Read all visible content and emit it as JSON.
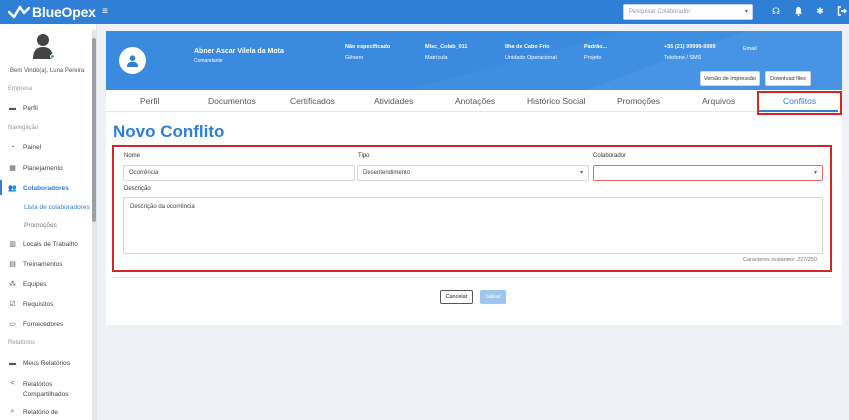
{
  "app": {
    "brand": "BlueOpex",
    "accent": "#2f7fd6"
  },
  "topbar": {
    "search_placeholder": "Pesquisar Colaborador",
    "icons": [
      "menu-icon",
      "headset-icon",
      "bell-icon",
      "gear-icon",
      "logout-icon"
    ]
  },
  "sidebar": {
    "welcome": "Bem Vindo(a), Luna Pereira",
    "sections": {
      "empresa": "Empresa",
      "navegacao": "Navegação",
      "relatorios": "Relatórios"
    },
    "items": {
      "perfil": "Perfil",
      "painel": "Painel",
      "planejamento": "Planejamento",
      "colaboradores": "Colaboradores",
      "lista": "Lista de colaboradores",
      "promocoes": "Promoções",
      "locais": "Locais de Trabalho",
      "treinamentos": "Treinamentos",
      "equipes": "Equipes",
      "requisitos": "Requisitos",
      "fornecedores": "Fornecedores",
      "meus_relatorios": "Meus Relatórios",
      "relatorios_compartilhados_1": "Relatórios",
      "relatorios_compartilhados_2": "Compartilhados",
      "relatorio_de": "Relatório de"
    }
  },
  "employee": {
    "name": "Abner Ascar Vilela da Mota",
    "role": "Comandante",
    "genero_val": "Não especificado",
    "genero_lbl": "Gênero",
    "matricula_val": "Misc_Colab_011",
    "matricula_lbl": "Matrícula",
    "unidade_val": "Ilha de Cabo Frio",
    "unidade_lbl": "Unidade Operacional",
    "projeto_val": "Padrão...",
    "projeto_lbl": "Projeto",
    "telefone_val": "+55 (21) 99999-9999",
    "telefone_lbl": "Telefone / SMS",
    "email_lbl": "Email",
    "print_btn": "Versão de Impressão",
    "download_btn": "Download files"
  },
  "tabs": {
    "perfil": "Perfil",
    "documentos": "Documentos",
    "certificados": "Certificados",
    "atividades": "Atividades",
    "anotacoes": "Anotações",
    "historico": "Histórico Social",
    "promocoes": "Promoções",
    "arquivos": "Arquivos",
    "conflitos": "Conflitos"
  },
  "form": {
    "title": "Novo Conflito",
    "nome_label": "Nome",
    "nome_value": "Ocorrência",
    "tipo_label": "Tipo",
    "tipo_value": "Desentendimento",
    "colaborador_label": "Colaborador",
    "colaborador_value": "",
    "descricao_label": "Descrição",
    "descricao_value": "Descrição da ocorrência",
    "char_count": "Caracteres restantes: 227/250",
    "cancel": "Cancelar",
    "save": "Salvar"
  }
}
